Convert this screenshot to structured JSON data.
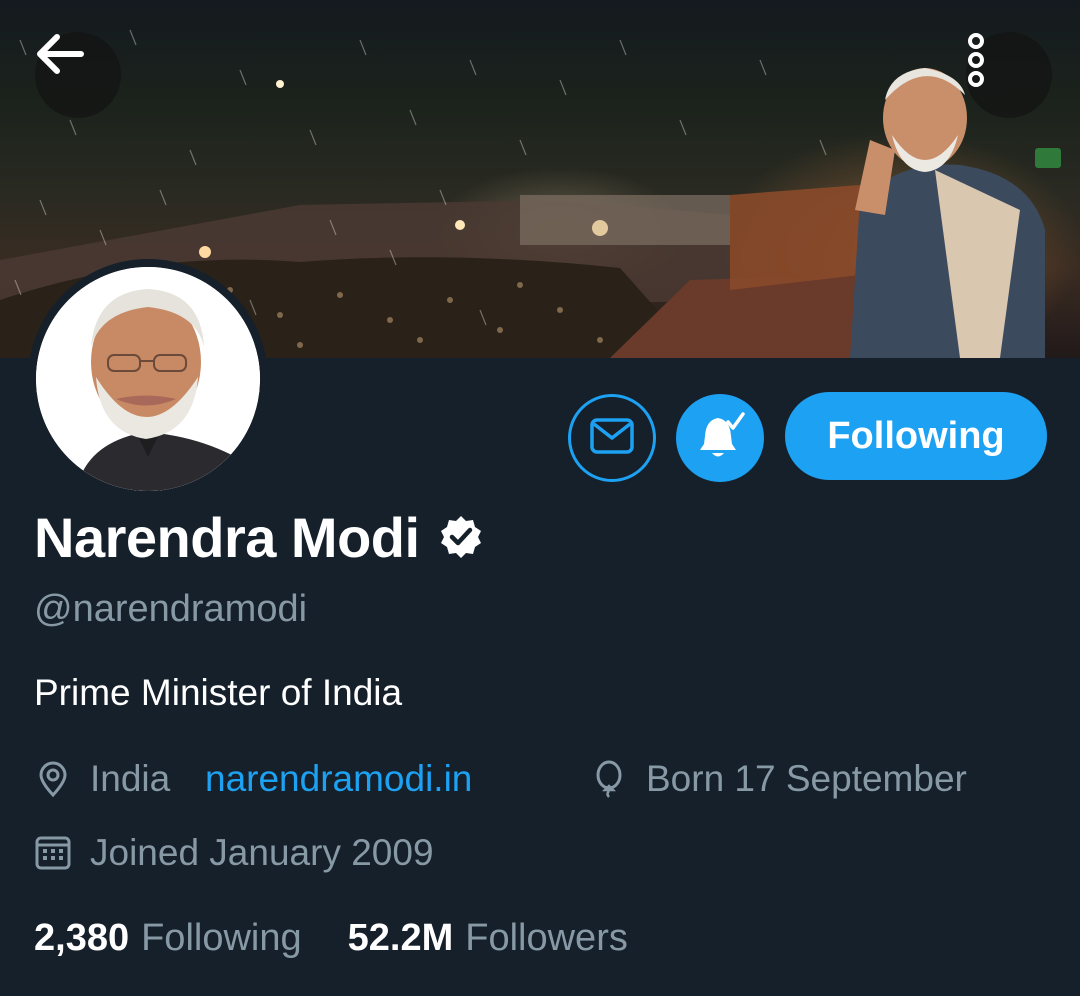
{
  "profile": {
    "display_name": "Narendra Modi",
    "handle": "@narendramodi",
    "bio": "Prime Minister of India",
    "location": "India",
    "website": "narendramodi.in",
    "birthday": "Born 17 September",
    "joined": "Joined January 2009"
  },
  "stats": {
    "following_count": "2,380",
    "following_label": "Following",
    "followers_count": "52.2M",
    "followers_label": "Followers"
  },
  "actions": {
    "follow_state_label": "Following"
  },
  "icons": {
    "back": "arrow-left-icon",
    "more": "more-vertical-icon",
    "message": "envelope-icon",
    "notifications": "bell-check-icon",
    "verified": "verified-badge-icon",
    "location": "location-pin-icon",
    "birthday": "balloon-icon",
    "joined": "calendar-icon"
  },
  "colors": {
    "background": "#15202b",
    "accent": "#1da1f2",
    "secondary_text": "#8899a6",
    "primary_text": "#ffffff"
  }
}
